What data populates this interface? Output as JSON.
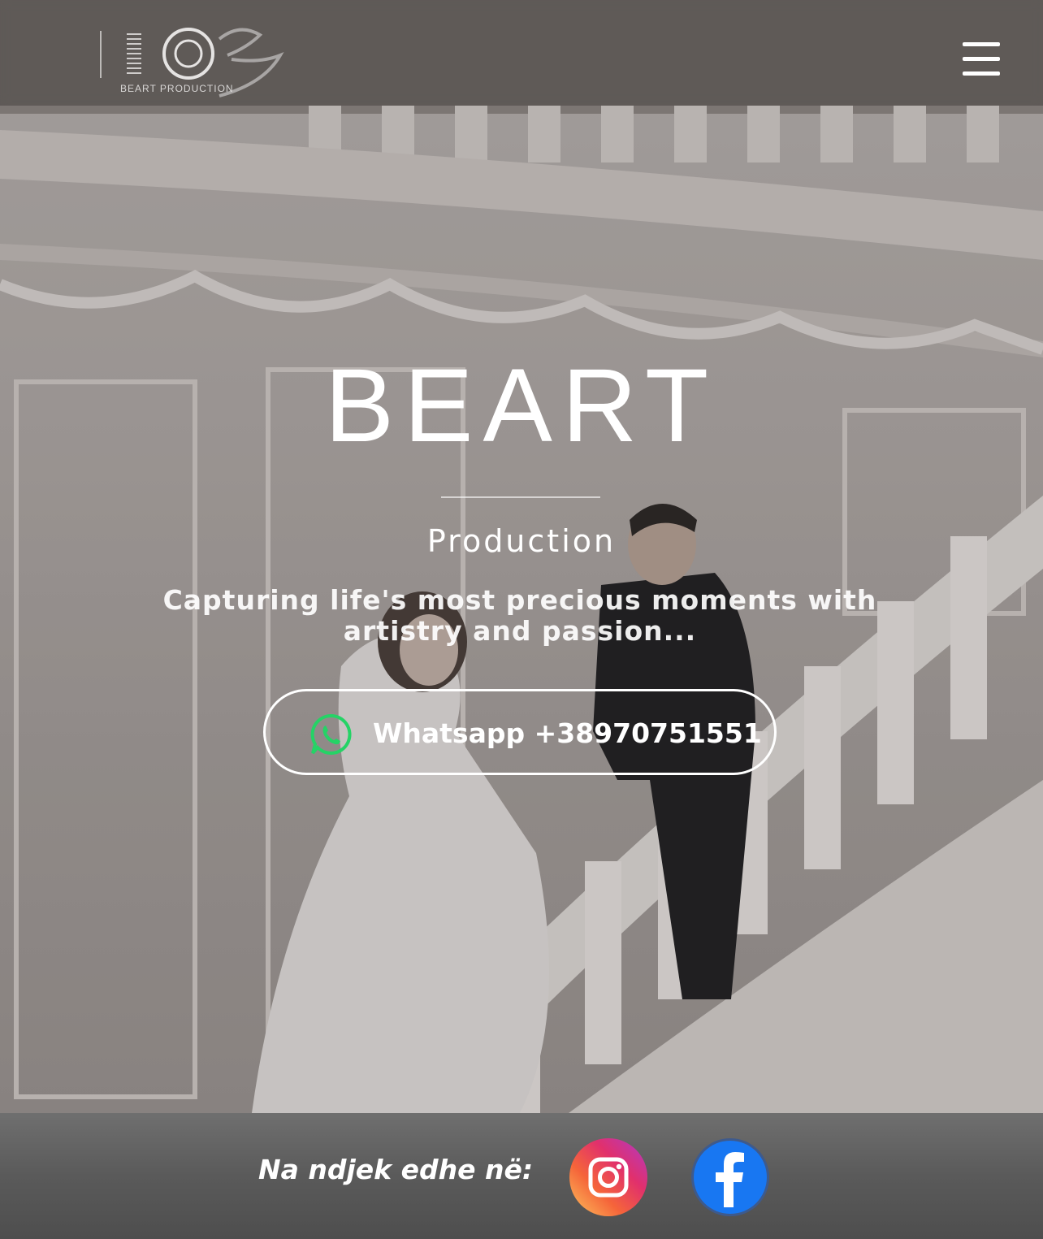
{
  "header": {
    "logo_text": "BEART PRODUCTION",
    "menu_icon": "hamburger-menu-icon"
  },
  "hero": {
    "title": "BEART",
    "subtitle": "Production",
    "tagline_line1": "Capturing life's most precious moments with",
    "tagline_line2": "artistry and passion...",
    "whatsapp_label": "Whatsapp +38970751551",
    "whatsapp_icon": "whatsapp-icon"
  },
  "footer": {
    "follow_label": "Na ndjek edhe në:",
    "instagram_icon": "instagram-icon",
    "facebook_icon": "facebook-icon"
  },
  "colors": {
    "text": "#ffffff",
    "whatsapp_green": "#25d366",
    "facebook_blue": "#1877f2",
    "footer_bg": "#5a5a5a"
  }
}
